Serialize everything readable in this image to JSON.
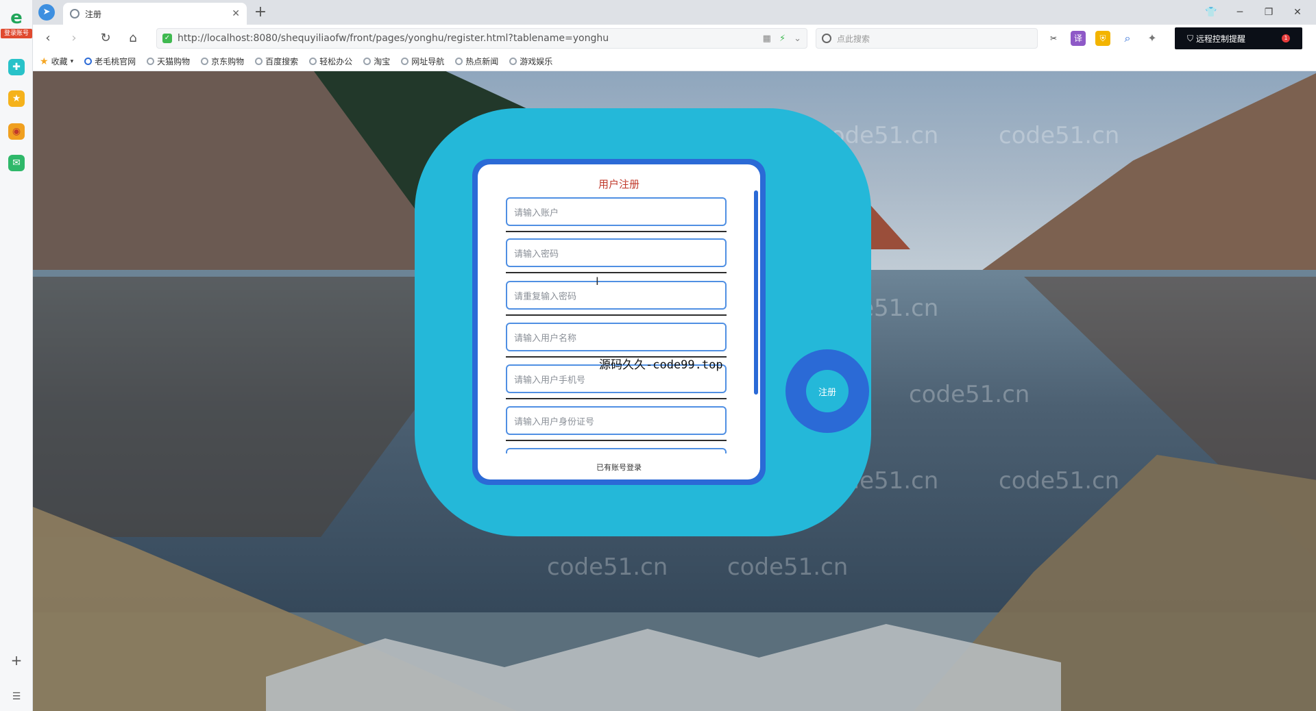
{
  "browser": {
    "sidebar_badge": "登录账号",
    "tab_title": "注册",
    "url": "http://localhost:8080/shequyiliaofw/front/pages/yonghu/register.html?tablename=yonghu",
    "search_placeholder": "点此搜索",
    "remote_label": "远程控制提醒",
    "remote_count": "1",
    "bookmarks": [
      "收藏",
      "老毛桃官网",
      "天猫购物",
      "京东购物",
      "百度搜索",
      "轻松办公",
      "淘宝",
      "网址导航",
      "热点新闻",
      "游戏娱乐"
    ]
  },
  "watermark": "code51.cn",
  "form": {
    "title": "用户注册",
    "fields": [
      {
        "placeholder": "请输入账户"
      },
      {
        "placeholder": "请输入密码"
      },
      {
        "placeholder": "请重复输入密码"
      },
      {
        "placeholder": "请输入用户名称"
      },
      {
        "placeholder": "请输入用户手机号"
      },
      {
        "placeholder": "请输入用户身份证号"
      }
    ],
    "login_link": "已有账号登录",
    "register_button": "注册"
  },
  "overlay_text": "源码久久-code99.top",
  "colors": {
    "card_outer": "#24b8d9",
    "card_frame": "#2b6ad6",
    "title": "#c0392b"
  }
}
